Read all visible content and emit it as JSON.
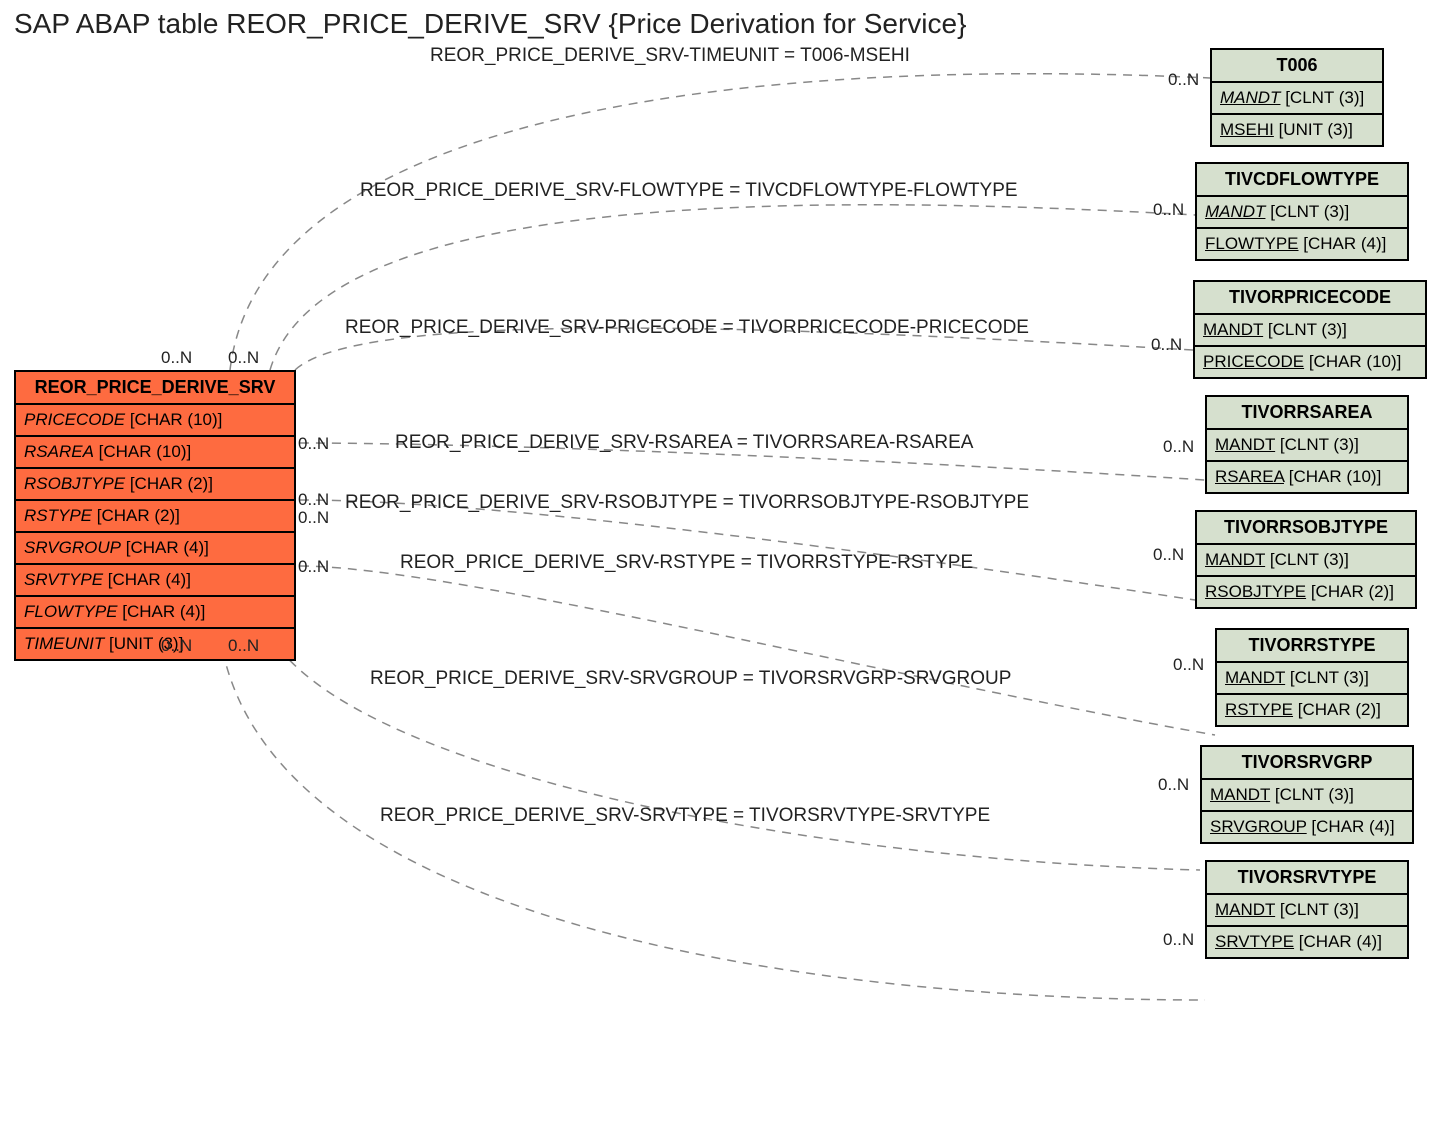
{
  "title": "SAP ABAP table REOR_PRICE_DERIVE_SRV {Price Derivation for Service}",
  "main_entity": {
    "name": "REOR_PRICE_DERIVE_SRV",
    "fields": [
      {
        "name": "PRICECODE",
        "type": "[CHAR (10)]"
      },
      {
        "name": "RSAREA",
        "type": "[CHAR (10)]"
      },
      {
        "name": "RSOBJTYPE",
        "type": "[CHAR (2)]"
      },
      {
        "name": "RSTYPE",
        "type": "[CHAR (2)]"
      },
      {
        "name": "SRVGROUP",
        "type": "[CHAR (4)]"
      },
      {
        "name": "SRVTYPE",
        "type": "[CHAR (4)]"
      },
      {
        "name": "FLOWTYPE",
        "type": "[CHAR (4)]"
      },
      {
        "name": "TIMEUNIT",
        "type": "[UNIT (3)]"
      }
    ]
  },
  "targets": [
    {
      "name": "T006",
      "fields": [
        {
          "name": "MANDT",
          "type": "[CLNT (3)]",
          "ital": true
        },
        {
          "name": "MSEHI",
          "type": "[UNIT (3)]"
        }
      ]
    },
    {
      "name": "TIVCDFLOWTYPE",
      "fields": [
        {
          "name": "MANDT",
          "type": "[CLNT (3)]",
          "ital": true
        },
        {
          "name": "FLOWTYPE",
          "type": "[CHAR (4)]"
        }
      ]
    },
    {
      "name": "TIVORPRICECODE",
      "fields": [
        {
          "name": "MANDT",
          "type": "[CLNT (3)]"
        },
        {
          "name": "PRICECODE",
          "type": "[CHAR (10)]"
        }
      ]
    },
    {
      "name": "TIVORRSAREA",
      "fields": [
        {
          "name": "MANDT",
          "type": "[CLNT (3)]"
        },
        {
          "name": "RSAREA",
          "type": "[CHAR (10)]"
        }
      ]
    },
    {
      "name": "TIVORRSOBJTYPE",
      "fields": [
        {
          "name": "MANDT",
          "type": "[CLNT (3)]"
        },
        {
          "name": "RSOBJTYPE",
          "type": "[CHAR (2)]"
        }
      ]
    },
    {
      "name": "TIVORRSTYPE",
      "fields": [
        {
          "name": "MANDT",
          "type": "[CLNT (3)]"
        },
        {
          "name": "RSTYPE",
          "type": "[CHAR (2)]"
        }
      ]
    },
    {
      "name": "TIVORSRVGRP",
      "fields": [
        {
          "name": "MANDT",
          "type": "[CLNT (3)]"
        },
        {
          "name": "SRVGROUP",
          "type": "[CHAR (4)]"
        }
      ]
    },
    {
      "name": "TIVORSRVTYPE",
      "fields": [
        {
          "name": "MANDT",
          "type": "[CLNT (3)]"
        },
        {
          "name": "SRVTYPE",
          "type": "[CHAR (4)]"
        }
      ]
    }
  ],
  "relations": [
    {
      "label": "REOR_PRICE_DERIVE_SRV-TIMEUNIT = T006-MSEHI"
    },
    {
      "label": "REOR_PRICE_DERIVE_SRV-FLOWTYPE = TIVCDFLOWTYPE-FLOWTYPE"
    },
    {
      "label": "REOR_PRICE_DERIVE_SRV-PRICECODE = TIVORPRICECODE-PRICECODE"
    },
    {
      "label": "REOR_PRICE_DERIVE_SRV-RSAREA = TIVORRSAREA-RSAREA"
    },
    {
      "label": "REOR_PRICE_DERIVE_SRV-RSOBJTYPE = TIVORRSOBJTYPE-RSOBJTYPE"
    },
    {
      "label": "REOR_PRICE_DERIVE_SRV-RSTYPE = TIVORRSTYPE-RSTYPE"
    },
    {
      "label": "REOR_PRICE_DERIVE_SRV-SRVGROUP = TIVORSRVGRP-SRVGROUP"
    },
    {
      "label": "REOR_PRICE_DERIVE_SRV-SRVTYPE = TIVORSRVTYPE-SRVTYPE"
    }
  ],
  "card": "0..N"
}
